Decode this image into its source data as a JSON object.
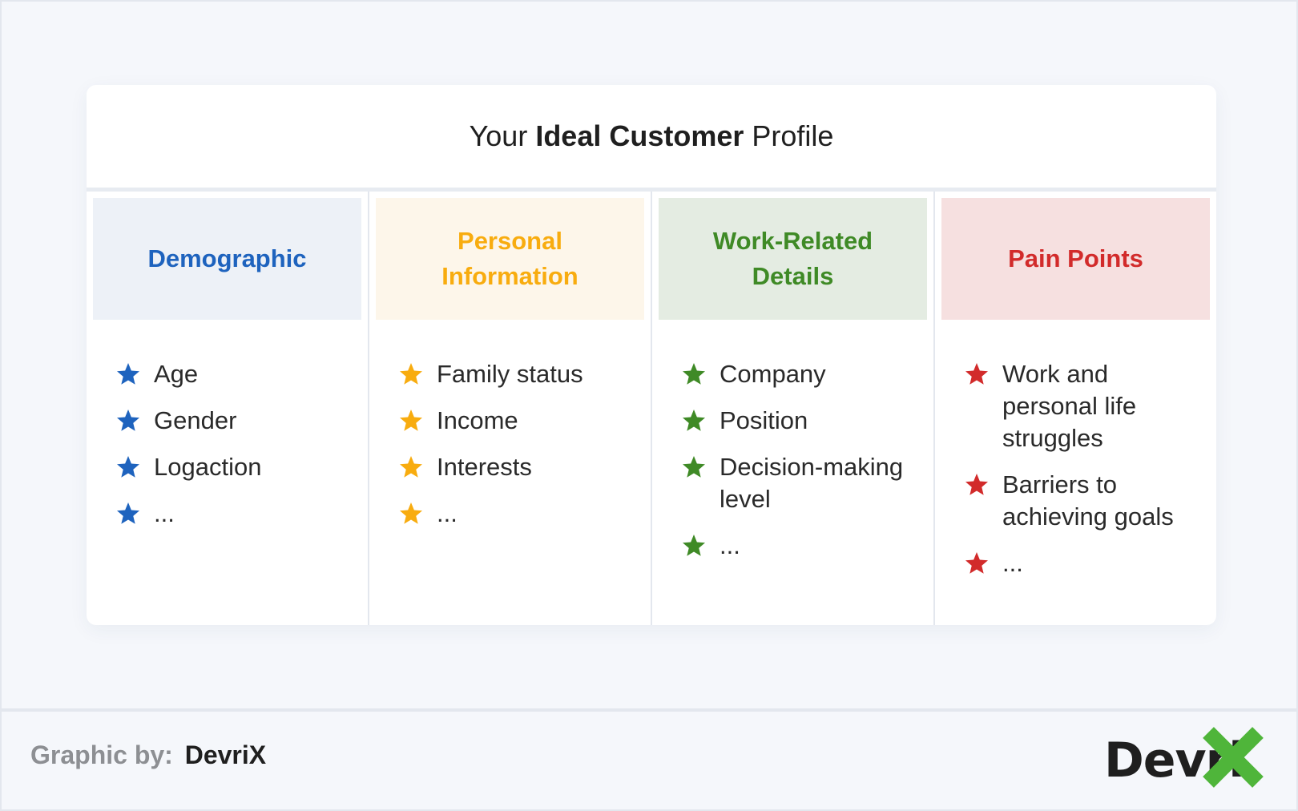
{
  "title": {
    "pre": "Your",
    "bold": "Ideal Customer",
    "post": "Profile"
  },
  "columns": [
    {
      "heading": "Demographic",
      "color": "#1e63be",
      "head_bg": "#edf1f7",
      "items": [
        "Age",
        "Gender",
        "Logaction",
        "..."
      ]
    },
    {
      "heading": "Personal\nInformation",
      "color": "#f8ac0f",
      "head_bg": "#fdf6ea",
      "items": [
        "Family status",
        "Income",
        "Interests",
        "..."
      ]
    },
    {
      "heading": "Work-Related\nDetails",
      "color": "#3f8a26",
      "head_bg": "#e4ece2",
      "items": [
        "Company",
        "Position",
        "Decision-making level",
        "..."
      ]
    },
    {
      "heading": "Pain Points",
      "color": "#d22b2b",
      "head_bg": "#f6e0e0",
      "items": [
        "Work and personal life struggles",
        "Barriers to achieving goals",
        "..."
      ]
    }
  ],
  "footer": {
    "label": "Graphic by:",
    "name": "DevriX",
    "logo_text": "Devri",
    "logo_x_color": "#4fb53a"
  }
}
